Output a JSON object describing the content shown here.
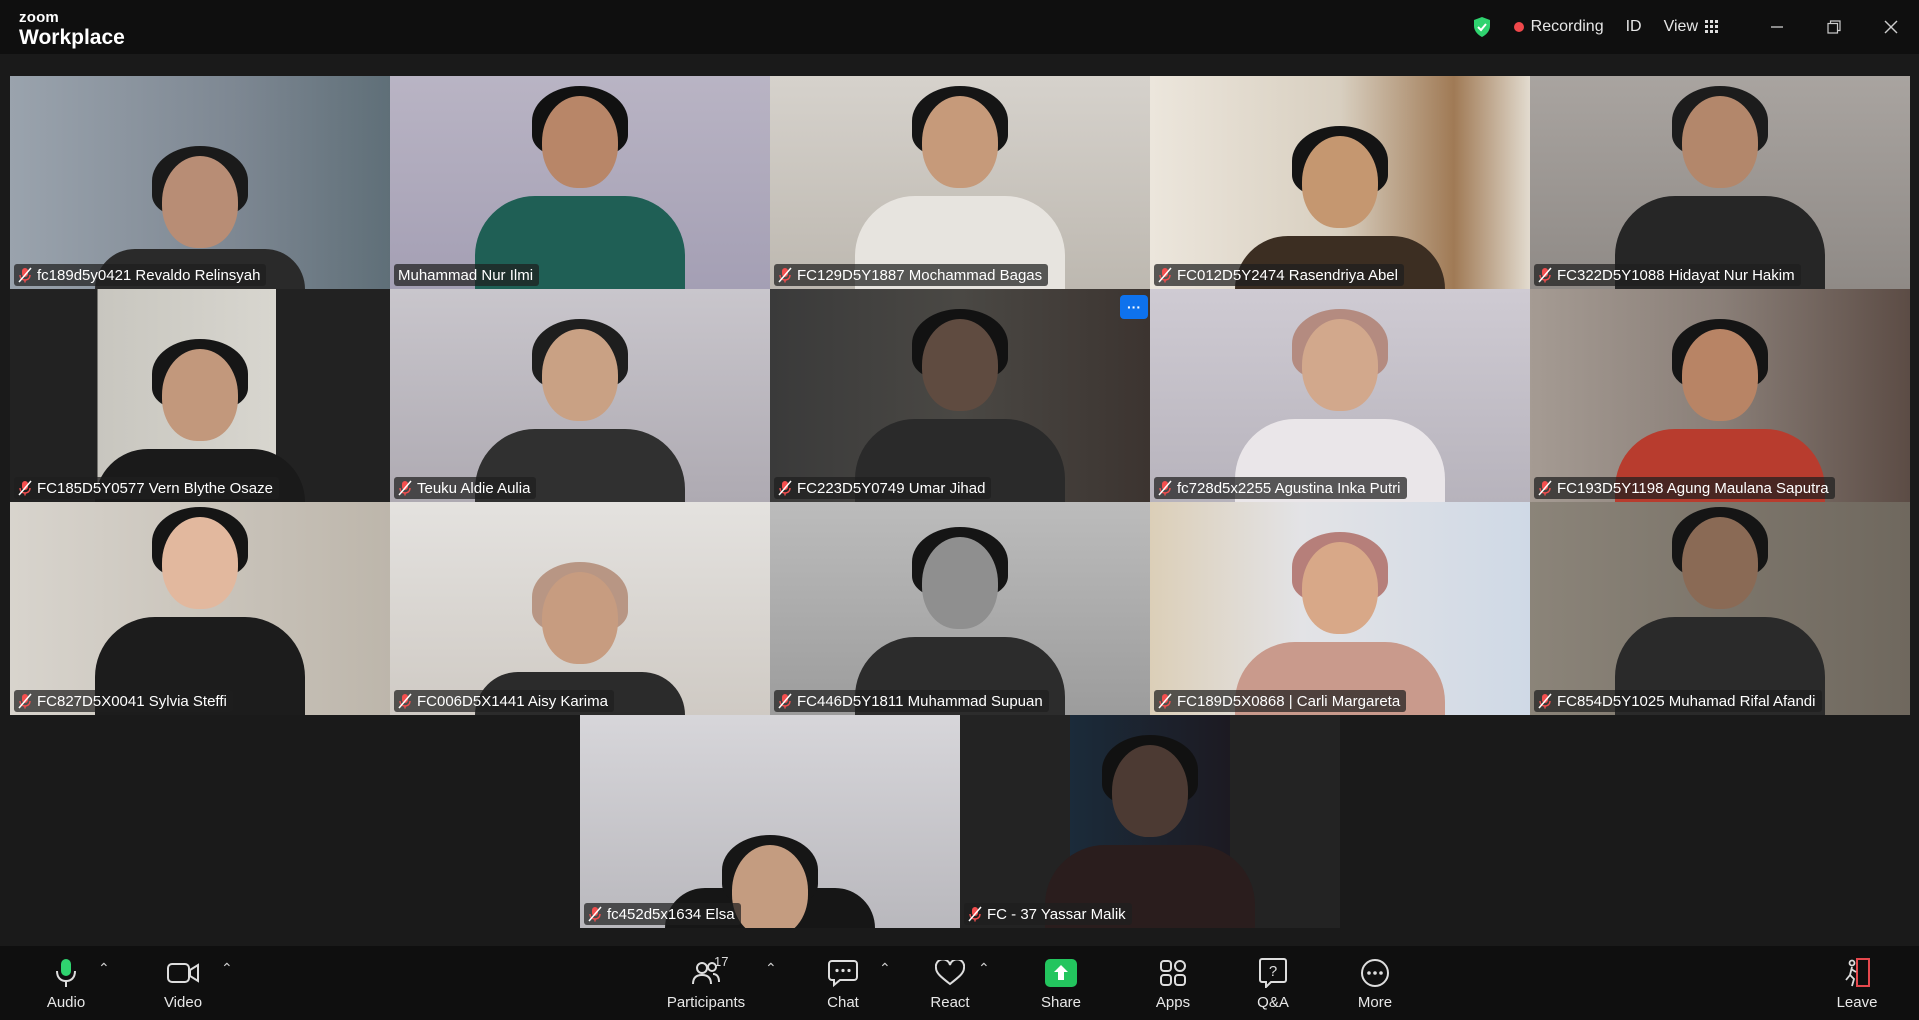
{
  "titlebar": {
    "brand_small": "zoom",
    "brand_big": "Workplace",
    "recording_label": "Recording",
    "id_label": "ID",
    "view_label": "View"
  },
  "participants": [
    {
      "name": "fc189d5y0421 Revaldo Relinsyah",
      "muted": true
    },
    {
      "name": "Muhammad Nur Ilmi",
      "muted": false,
      "active_speaker": true
    },
    {
      "name": "FC129D5Y1887 Mochammad Bagas",
      "muted": true
    },
    {
      "name": "FC012D5Y2474 Rasendriya Abel",
      "muted": true
    },
    {
      "name": "FC322D5Y1088 Hidayat Nur Hakim",
      "muted": true
    },
    {
      "name": "FC185D5Y0577 Vern Blythe Osaze",
      "muted": true
    },
    {
      "name": "Teuku Aldie Aulia",
      "muted": true
    },
    {
      "name": "FC223D5Y0749 Umar Jihad",
      "muted": true,
      "more_badge": "···"
    },
    {
      "name": "fc728d5x2255 Agustina Inka Putri",
      "muted": true
    },
    {
      "name": "FC193D5Y1198 Agung Maulana Saputra",
      "muted": true
    },
    {
      "name": "FC827D5X0041 Sylvia Steffi",
      "muted": true
    },
    {
      "name": "FC006D5X1441 Aisy Karima",
      "muted": true
    },
    {
      "name": "FC446D5Y1811 Muhammad Supuan",
      "muted": true
    },
    {
      "name": "FC189D5X0868 | Carli Margareta",
      "muted": true
    },
    {
      "name": "FC854D5Y1025 Muhamad Rifal Afandi",
      "muted": true
    },
    {
      "name": "fc452d5x1634 Elsa",
      "muted": true
    },
    {
      "name": "FC - 37 Yassar Malik",
      "muted": true
    }
  ],
  "toolbar": {
    "audio": "Audio",
    "video": "Video",
    "participants": "Participants",
    "participants_count": "17",
    "chat": "Chat",
    "react": "React",
    "share": "Share",
    "apps": "Apps",
    "qa": "Q&A",
    "more": "More",
    "leave": "Leave"
  },
  "colors": {
    "active_border": "#2fd36f",
    "recording_dot": "#f0484b",
    "share_green": "#23c55e",
    "badge_blue": "#0e72ed",
    "leave_red": "#e5484d"
  }
}
